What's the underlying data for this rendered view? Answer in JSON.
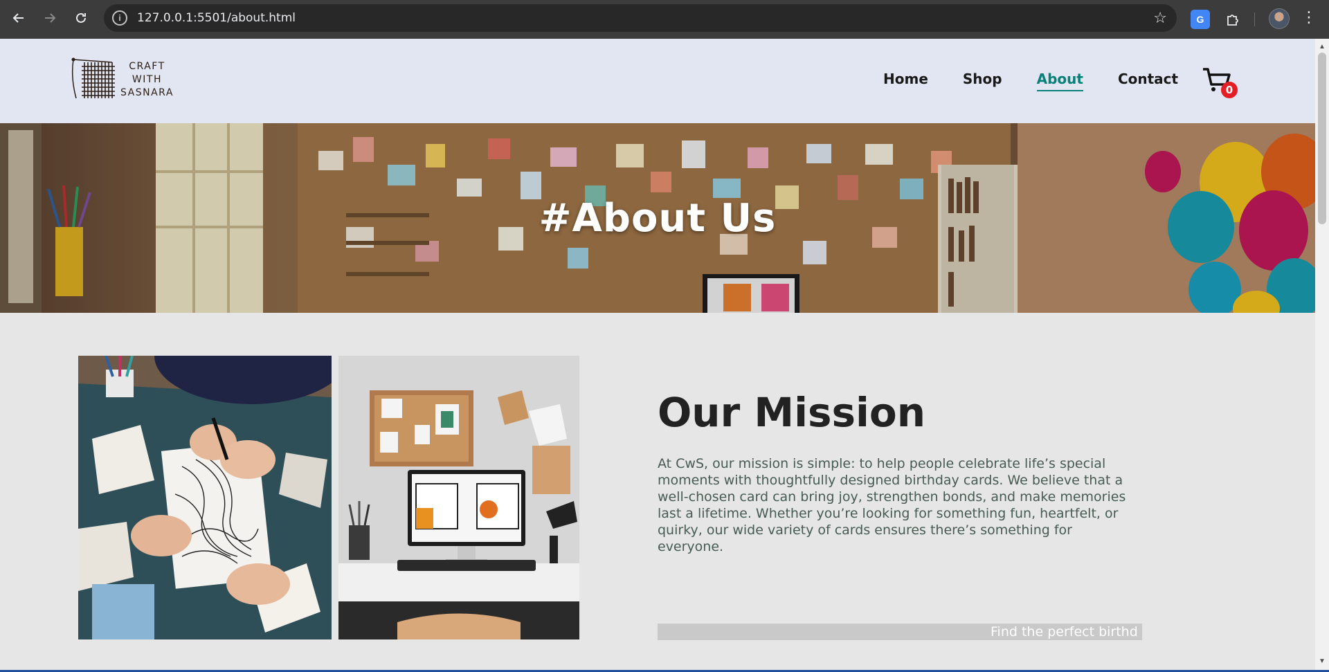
{
  "browser": {
    "url": "127.0.0.1:5501/about.html",
    "icons": {
      "back": "arrow-left-icon",
      "forward": "arrow-right-icon",
      "reload": "reload-icon",
      "site_info": "info-icon",
      "bookmark": "star-icon",
      "translate": "google-translate-icon",
      "extensions": "puzzle-icon",
      "menu": "more-vert-icon"
    },
    "translate_label": "G"
  },
  "header": {
    "logo": {
      "line1": "CRAFT",
      "line2": "WITH",
      "line3": "SASNARA"
    },
    "nav": [
      {
        "label": "Home",
        "active": false
      },
      {
        "label": "Shop",
        "active": false
      },
      {
        "label": "About",
        "active": true
      },
      {
        "label": "Contact",
        "active": false
      }
    ],
    "cart_count": "0",
    "accent_color": "#088178",
    "badge_color": "#e41e26"
  },
  "hero": {
    "title": "#About Us"
  },
  "about": {
    "mission_title": "Our Mission",
    "mission_text": "At CwS, our mission is simple: to help people celebrate life’s special moments with thoughtfully designed birthday cards. We believe that a well-chosen card can bring joy, strengthen bonds, and make memories last a lifetime. Whether you’re looking for something fun, heartfelt, or quirky, our wide variety of cards ensures there’s something for everyone.",
    "marquee_text": "Find the perfect birthd"
  }
}
